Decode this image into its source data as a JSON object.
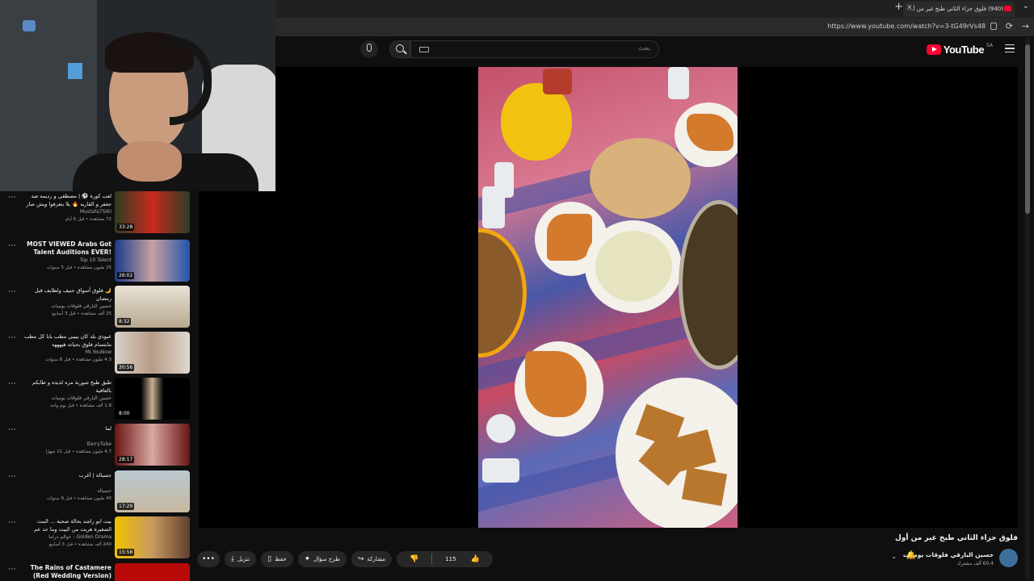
{
  "browser": {
    "tab_title": "(940) فلوق جزاء الثاني طبخ غير من أ...",
    "url": "https://www.youtube.com/watch?v=3-tG49rVs48"
  },
  "masthead": {
    "search_placeholder": "بحث",
    "logo_text": "YouTube",
    "region": "SA"
  },
  "video": {
    "title": "فلوق جزاء الثاني طبخ غير من أول",
    "channel": "حسين البارقي فلوقات يوميات",
    "subscribers": "60.4 ألف مشترك",
    "likes": "115"
  },
  "actions": {
    "share": "مشاركة",
    "ask": "طرح سؤال",
    "save": "حفظ",
    "download": "تنزيل"
  },
  "related": [
    {
      "title": "لعب كورة ⚽️ | مصطفى و رديمه ضد جعفر و القاريه 🔥 يلا بتعرفوا ويش صار صرا...",
      "channel": "Mustafa7SIKI",
      "meta": "72 مشاهدة • قبل 6 أيام",
      "duration": "33:28",
      "ltr": false
    },
    {
      "title": "MOST VIEWED Arabs Got Talent Auditions EVER!",
      "channel": "Top 10 Talent",
      "meta": "25 مليون مشاهدة • قبل 5 سنوات",
      "duration": "26:02",
      "ltr": true
    },
    {
      "title": "🌙 فلوق أسواق جنيف ولطايف قبل رمضان",
      "channel": "حسين البارقي فلوقات يوميات",
      "meta": "25 ألف مشاهدة • قبل 3 أسابيع",
      "duration": "8:32",
      "ltr": false
    },
    {
      "title": "عبودي بلد كان يبيبي مطب بابا كل مطب مابتسام فلوق بحياته هيهههه",
      "channel": "Mr.YouNow",
      "meta": "4.3 مليون مشاهدة • قبل 8 سنوات",
      "duration": "30:56",
      "ltr": false
    },
    {
      "title": "طبق طبخ شوربة مره لذيذه و طابكم بالعافية",
      "channel": "حسين البارقي فلوقات يوميات",
      "meta": "1.8 ألف مشاهدة • قبل يوم واحد",
      "duration": "8:00",
      "ltr": false
    },
    {
      "title": "لما",
      "channel": "BarryTube",
      "meta": "4.7 مليون مشاهدة • قبل 11 شهرًا",
      "duration": "28:17",
      "ltr": false
    },
    {
      "title": "حسبالة | أغرب",
      "channel": "حسبالة",
      "meta": "40 مليون مشاهدة • قبل 9 سنوات",
      "duration": "17:29",
      "ltr": false
    },
    {
      "title": "بيت ابو راشد بحالة صحية ... البنت الصغيرة هربت من البيت وما حد عم يعرف وينها ...",
      "channel": "Golden Drama - عوالم دراما",
      "meta": "240 ألف مشاهدة • قبل 3 أسابيع",
      "duration": "15:58",
      "ltr": false
    },
    {
      "title": "The Rains of Castamere (Red Wedding Version)",
      "channel": "",
      "meta": "",
      "duration": "",
      "ltr": true
    }
  ],
  "colors": {
    "accent": "#ff0033",
    "background": "#0f0f0f",
    "pill": "#272727"
  }
}
